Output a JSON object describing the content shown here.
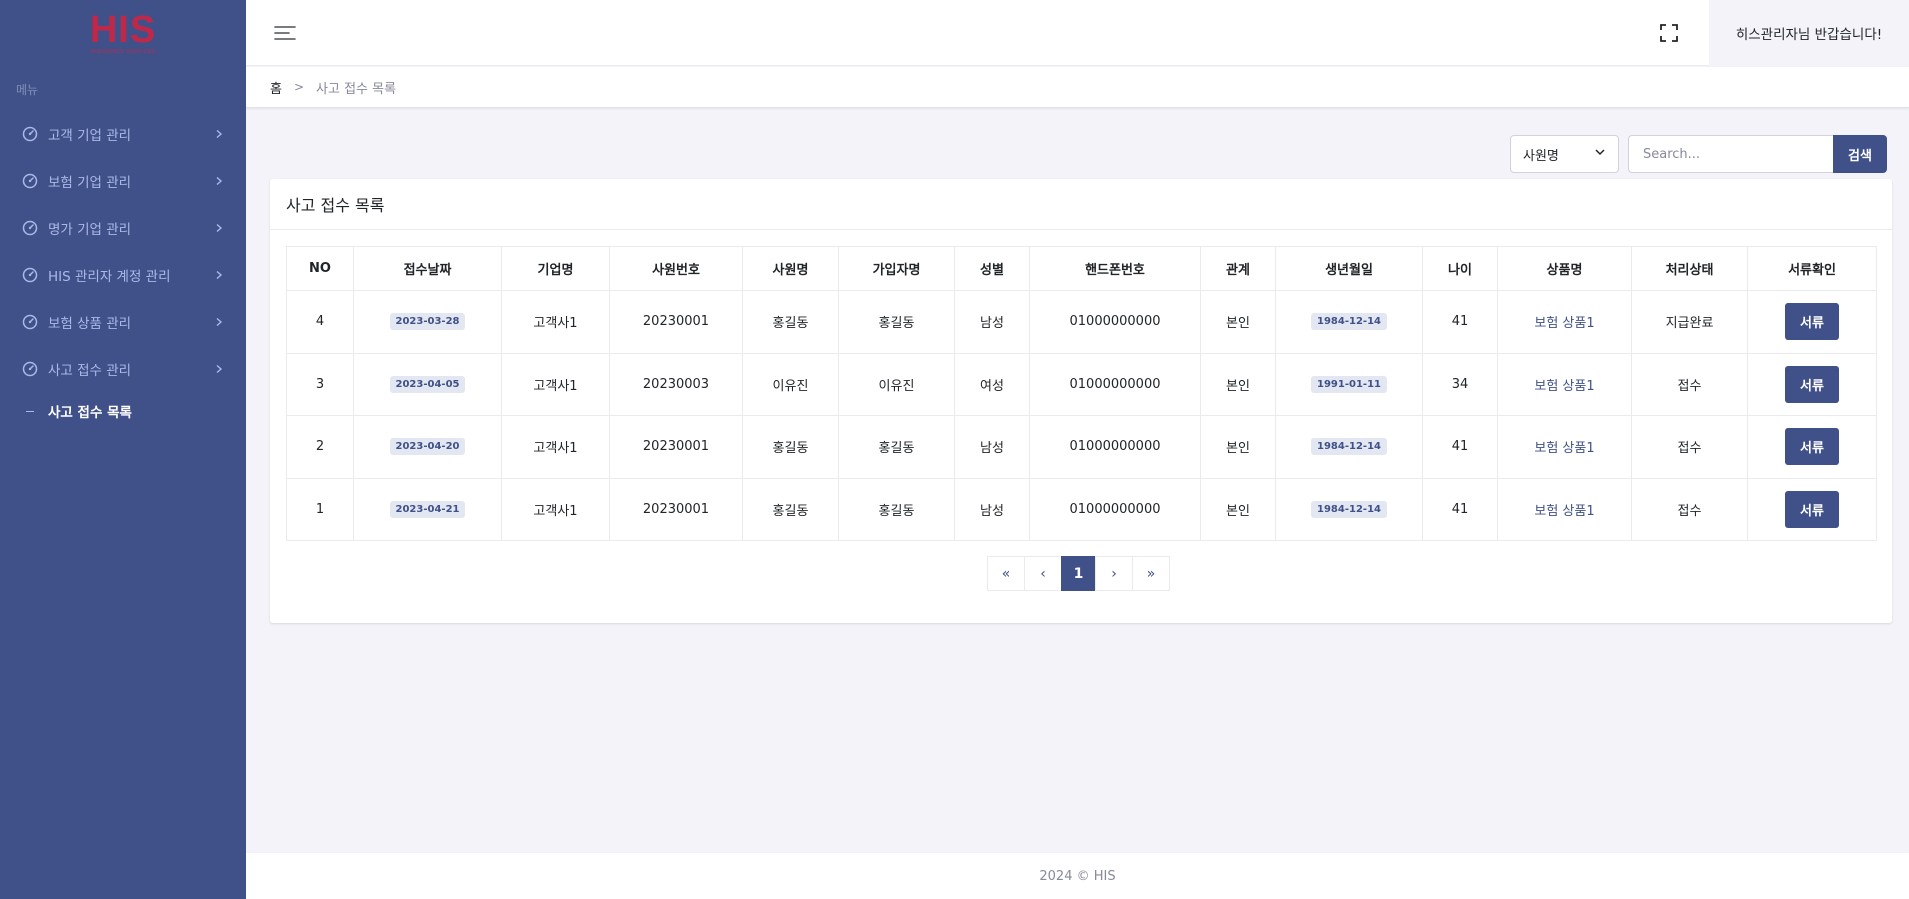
{
  "logo": {
    "text": "HIS",
    "sub": "INSURANCE SERVICES"
  },
  "sidebar": {
    "menu_title": "메뉴",
    "items": [
      {
        "label": "고객 기업 관리",
        "icon": "gauge-icon"
      },
      {
        "label": "보험 기업 관리",
        "icon": "gauge-icon"
      },
      {
        "label": "명가 기업 관리",
        "icon": "gauge-icon"
      },
      {
        "label": "HIS 관리자 계정 관리",
        "icon": "gauge-icon"
      },
      {
        "label": "보험 상품 관리",
        "icon": "gauge-icon"
      },
      {
        "label": "사고 접수 관리",
        "icon": "gauge-icon"
      }
    ],
    "sub_item": "사고 접수 목록"
  },
  "header": {
    "greeting": "히스관리자님 반갑습니다!"
  },
  "breadcrumb": {
    "home": "홈",
    "separator": ">",
    "current": "사고 접수 목록"
  },
  "search": {
    "select_value": "사원명",
    "placeholder": "Search...",
    "button_label": "검색"
  },
  "card": {
    "title": "사고 접수 목록"
  },
  "table": {
    "headers": [
      "NO",
      "접수날짜",
      "기업명",
      "사원번호",
      "사원명",
      "가입자명",
      "성별",
      "핸드폰번호",
      "관계",
      "생년월일",
      "나이",
      "상품명",
      "처리상태",
      "서류확인"
    ],
    "rows": [
      {
        "no": "4",
        "date": "2023-03-28",
        "company": "고객사1",
        "emp_no": "20230001",
        "emp_name": "홍길동",
        "subscriber": "홍길동",
        "gender": "남성",
        "phone": "01000000000",
        "relation": "본인",
        "birth": "1984-12-14",
        "age": "41",
        "product": "보험 상품1",
        "status": "지급완료",
        "doc": "서류"
      },
      {
        "no": "3",
        "date": "2023-04-05",
        "company": "고객사1",
        "emp_no": "20230003",
        "emp_name": "이유진",
        "subscriber": "이유진",
        "gender": "여성",
        "phone": "01000000000",
        "relation": "본인",
        "birth": "1991-01-11",
        "age": "34",
        "product": "보험 상품1",
        "status": "접수",
        "doc": "서류"
      },
      {
        "no": "2",
        "date": "2023-04-20",
        "company": "고객사1",
        "emp_no": "20230001",
        "emp_name": "홍길동",
        "subscriber": "홍길동",
        "gender": "남성",
        "phone": "01000000000",
        "relation": "본인",
        "birth": "1984-12-14",
        "age": "41",
        "product": "보험 상품1",
        "status": "접수",
        "doc": "서류"
      },
      {
        "no": "1",
        "date": "2023-04-21",
        "company": "고객사1",
        "emp_no": "20230001",
        "emp_name": "홍길동",
        "subscriber": "홍길동",
        "gender": "남성",
        "phone": "01000000000",
        "relation": "본인",
        "birth": "1984-12-14",
        "age": "41",
        "product": "보험 상품1",
        "status": "접수",
        "doc": "서류"
      }
    ]
  },
  "pagination": {
    "first": "«",
    "prev": "‹",
    "current": "1",
    "next": "›",
    "last": "»"
  },
  "footer": {
    "text": "2024 © HIS"
  },
  "colors": {
    "primary": "#405189",
    "sidebar_text": "#abb9e8",
    "logo": "#c0284a",
    "background": "#f3f3f9"
  }
}
